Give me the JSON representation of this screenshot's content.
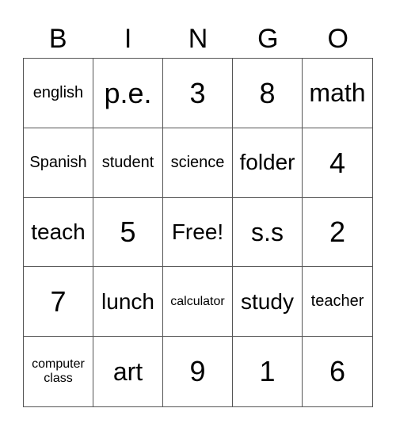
{
  "card": {
    "header": [
      "B",
      "I",
      "N",
      "G",
      "O"
    ],
    "rows": [
      [
        {
          "text": "english",
          "size": "s"
        },
        {
          "text": "p.e.",
          "size": "xl"
        },
        {
          "text": "3",
          "size": "xl"
        },
        {
          "text": "8",
          "size": "xl"
        },
        {
          "text": "math",
          "size": "l"
        }
      ],
      [
        {
          "text": "Spanish",
          "size": "s"
        },
        {
          "text": "student",
          "size": "s"
        },
        {
          "text": "science",
          "size": "s"
        },
        {
          "text": "folder",
          "size": "m"
        },
        {
          "text": "4",
          "size": "xl"
        }
      ],
      [
        {
          "text": "teach",
          "size": "m"
        },
        {
          "text": "5",
          "size": "xl"
        },
        {
          "text": "Free!",
          "size": "m"
        },
        {
          "text": "s.s",
          "size": "l"
        },
        {
          "text": "2",
          "size": "xl"
        }
      ],
      [
        {
          "text": "7",
          "size": "xl"
        },
        {
          "text": "lunch",
          "size": "m"
        },
        {
          "text": "calculator",
          "size": "xs"
        },
        {
          "text": "study",
          "size": "m"
        },
        {
          "text": "teacher",
          "size": "s"
        }
      ],
      [
        {
          "text": "computer class",
          "size": "xs"
        },
        {
          "text": "art",
          "size": "l"
        },
        {
          "text": "9",
          "size": "xl"
        },
        {
          "text": "1",
          "size": "xl"
        },
        {
          "text": "6",
          "size": "xl"
        }
      ]
    ]
  }
}
